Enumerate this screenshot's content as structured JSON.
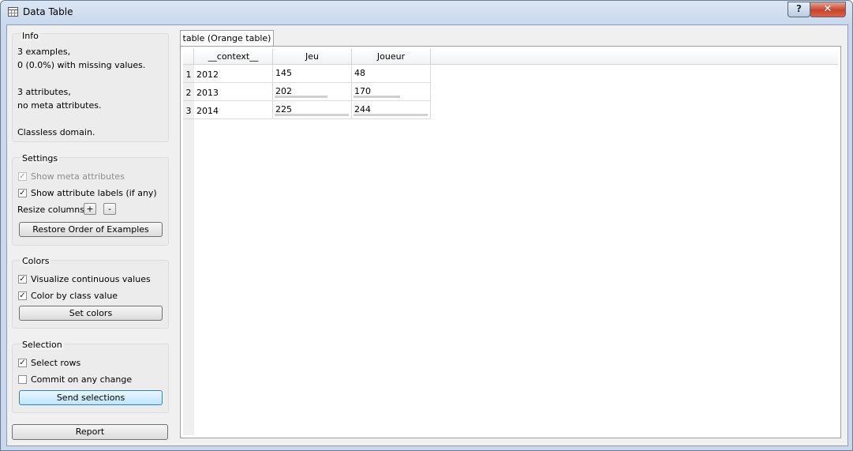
{
  "window": {
    "title": "Data Table",
    "help_label": "?",
    "close_label": "✕"
  },
  "info": {
    "title": "Info",
    "lines": [
      "3 examples,",
      "0 (0.0%) with missing values.",
      "3 attributes,",
      "no meta attributes.",
      "Classless domain."
    ]
  },
  "settings": {
    "title": "Settings",
    "show_meta": {
      "label": "Show meta attributes",
      "checked": true,
      "disabled": true
    },
    "show_labels": {
      "label": "Show attribute labels (if any)",
      "checked": true
    },
    "resize_label": "Resize columns:",
    "plus_label": "+",
    "minus_label": "-",
    "restore_label": "Restore Order of Examples"
  },
  "colors": {
    "title": "Colors",
    "visualize": {
      "label": "Visualize continuous values",
      "checked": true
    },
    "color_by_class": {
      "label": "Color by class value",
      "checked": true
    },
    "set_colors_label": "Set colors"
  },
  "selection": {
    "title": "Selection",
    "select_rows": {
      "label": "Select rows",
      "checked": true
    },
    "commit": {
      "label": "Commit on any change",
      "checked": false
    },
    "send_label": "Send selections"
  },
  "report_label": "Report",
  "tab_label": "table (Orange table)",
  "table": {
    "headers": [
      "__context__",
      "Jeu",
      "Joueur"
    ],
    "rows": [
      {
        "num": "1",
        "context": "2012",
        "jeu": "145",
        "joueur": "48",
        "jeu_fill": 0,
        "joueur_fill": 0
      },
      {
        "num": "2",
        "context": "2013",
        "jeu": "202",
        "joueur": "170",
        "jeu_fill": 0.71,
        "joueur_fill": 0.63
      },
      {
        "num": "3",
        "context": "2014",
        "jeu": "225",
        "joueur": "244",
        "jeu_fill": 1.0,
        "joueur_fill": 1.0
      }
    ]
  },
  "colors_theme": {
    "bar": "#d0d0d0",
    "window_frame": "#c9d8ec",
    "close_button": "#c7432c"
  }
}
